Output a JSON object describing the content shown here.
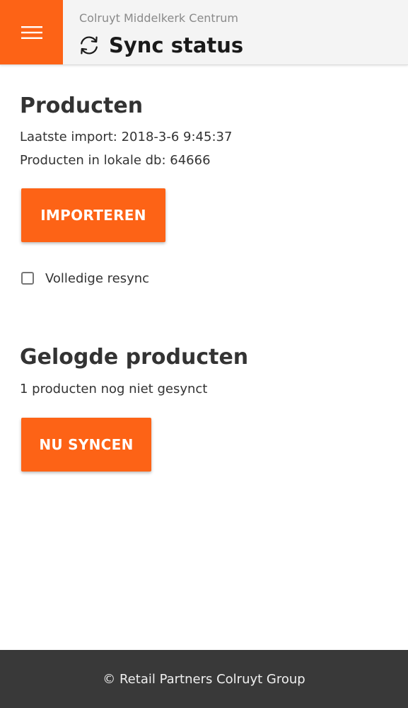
{
  "header": {
    "store_name": "Colruyt Middelkerk Centrum",
    "title": "Sync status",
    "menu_icon": "hamburger-menu-icon",
    "title_icon": "sync-icon"
  },
  "products": {
    "title": "Producten",
    "last_import": "Laatste import: 2018-3-6 9:45:37",
    "local_db_count": "Producten in lokale db: 64666",
    "import_button_label": "IMPORTEREN",
    "full_resync_label": "Volledige resync",
    "full_resync_checked": false
  },
  "logged_products": {
    "title": "Gelogde producten",
    "status": "1 producten nog niet gesynct",
    "sync_button_label": "NU SYNCEN"
  },
  "footer": {
    "text": "© Retail Partners Colruyt Group"
  },
  "colors": {
    "accent": "#fd6316",
    "header_bg": "#f4f4f4",
    "footer_bg": "#393939"
  }
}
